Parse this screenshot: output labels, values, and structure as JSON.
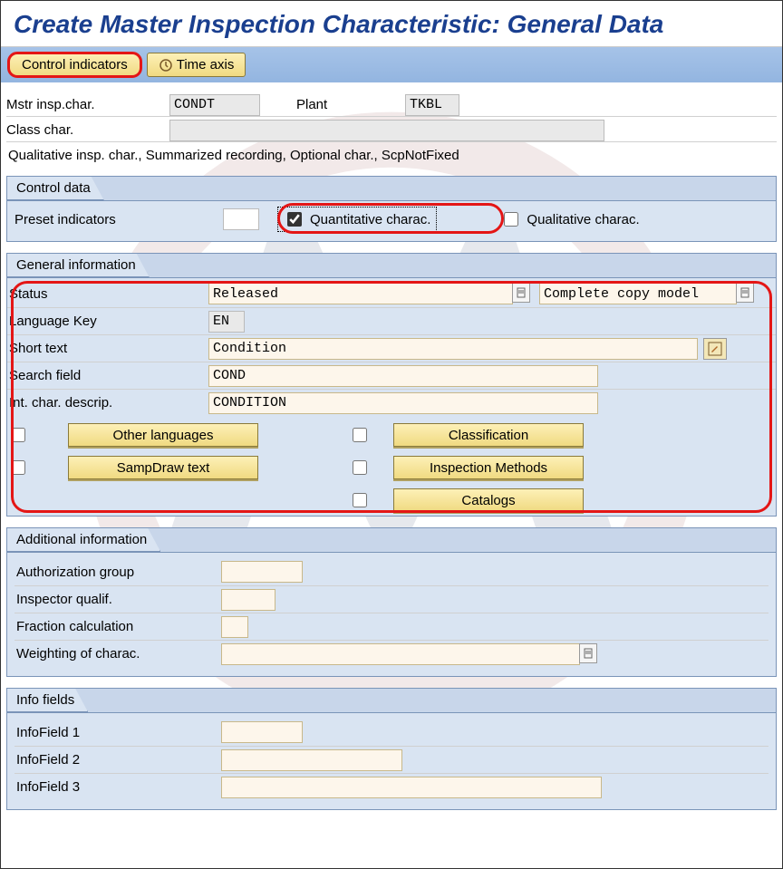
{
  "title": "Create Master Inspection Characteristic: General Data",
  "toolbar": {
    "control_indicators": "Control indicators",
    "time_axis": "Time axis"
  },
  "header": {
    "master_char_label": "Mstr insp.char.",
    "master_char_value": "CONDT",
    "plant_label": "Plant",
    "plant_value": "TKBL",
    "class_char_label": "Class char.",
    "class_char_value": "",
    "summary": "Qualitative insp. char., Summarized recording, Optional char., ScpNotFixed"
  },
  "control_data": {
    "tab": "Control data",
    "preset_label": "Preset indicators",
    "preset_value": "",
    "quantitative_label": "Quantitative charac.",
    "quantitative_checked": true,
    "qualitative_label": "Qualitative charac.",
    "qualitative_checked": false
  },
  "general": {
    "tab": "General information",
    "status_label": "Status",
    "status_value": "Released",
    "copy_model_value": "Complete copy model",
    "lang_label": "Language Key",
    "lang_value": "EN",
    "short_text_label": "Short text",
    "short_text_value": "Condition",
    "search_label": "Search field",
    "search_value": "COND",
    "int_label": "Int. char. descrip.",
    "int_value": "CONDITION",
    "buttons": {
      "other_languages": "Other languages",
      "sampdraw": "SampDraw text",
      "classification": "Classification",
      "inspection_methods": "Inspection Methods",
      "catalogs": "Catalogs"
    }
  },
  "additional": {
    "tab": "Additional information",
    "auth_group_label": "Authorization group",
    "inspector_label": "Inspector qualif.",
    "fraction_label": "Fraction calculation",
    "weighting_label": "Weighting of charac."
  },
  "info": {
    "tab": "Info fields",
    "f1": "InfoField 1",
    "f2": "InfoField 2",
    "f3": "InfoField 3"
  }
}
